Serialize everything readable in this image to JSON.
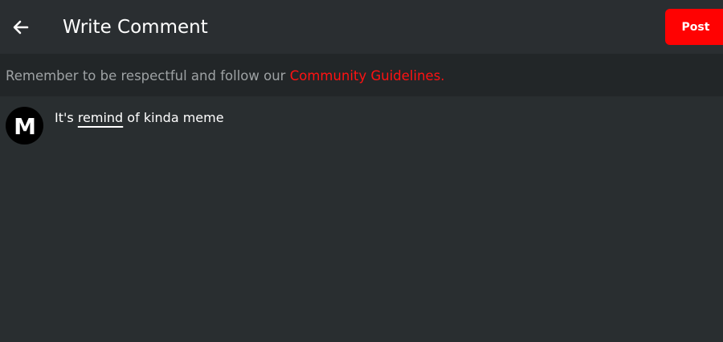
{
  "header": {
    "back_icon": "arrow-left-icon",
    "title": "Write Comment",
    "post_label": "Post"
  },
  "notice": {
    "text": "Remember to be respectful and follow our ",
    "link_text": "Community Guidelines."
  },
  "comment": {
    "avatar_letter": "M",
    "text_before": "It's ",
    "underlined_word": "remind",
    "text_after": " of kinda meme"
  },
  "colors": {
    "background": "#292e30",
    "notice_background": "#222628",
    "accent": "#ff0202",
    "link": "#ff1212"
  }
}
